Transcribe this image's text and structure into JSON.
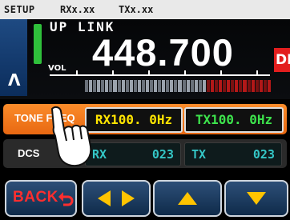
{
  "header": {
    "setup_label": "SETUP",
    "rx_text": "RXx.xx",
    "tx_text": "TXx.xx"
  },
  "display": {
    "mode_label": "UP LINK",
    "frequency": "448.700",
    "vol_label": "VOL",
    "direction_badge": "DN",
    "vfo_arrow": "Λ"
  },
  "tone": {
    "label": "TONE FREQ",
    "rx_value": "RX100. 0Hz",
    "tx_value": "TX100. 0Hz"
  },
  "dcs": {
    "label": "DCS",
    "rx_label": "RX",
    "rx_value": "023",
    "tx_label": "TX",
    "tx_value": "023"
  },
  "buttons": {
    "back_label": "BACK"
  },
  "icons": {
    "hand": "pointing-hand-icon",
    "back_arrow": "return-arrow-icon",
    "left_right": "left-right-arrows-icon",
    "up": "up-triangle-icon",
    "down": "down-triangle-icon"
  },
  "colors": {
    "background": "#000000",
    "tone_row": "#f47c20",
    "rx_tone_text": "#ffe400",
    "tx_tone_text": "#3de34c",
    "dcs_text": "#34c6c6",
    "button_face": "#1d3f66",
    "back_text": "#ff2e2e",
    "yellow_arrows": "#ffc400",
    "dn_badge": "#e31e1e"
  }
}
